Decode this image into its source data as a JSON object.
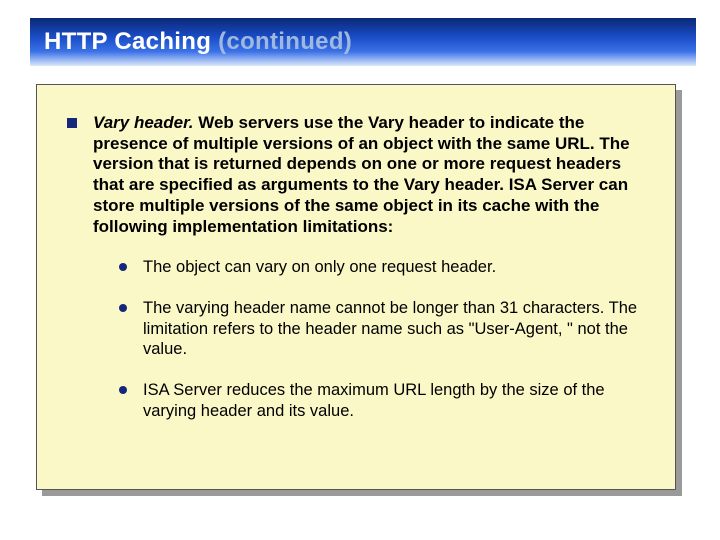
{
  "title": {
    "main": "HTTP Caching ",
    "continued": "(continued)"
  },
  "mainItem": {
    "lead": "Vary header.",
    "body": " Web servers use the Vary header to indicate the presence of multiple versions of an object with the same URL. The version that is returned depends on one or more request headers that are specified as arguments to the Vary header. ISA Server can store multiple versions of the same object in its cache with the following implementation limitations:"
  },
  "subItems": [
    "The object can vary on only one request header.",
    "The varying header name cannot be longer than 31 characters. The limitation refers to the header name such as \"User-Agent, \" not the value.",
    "ISA Server reduces the maximum URL length by the size of the varying header and its value."
  ]
}
